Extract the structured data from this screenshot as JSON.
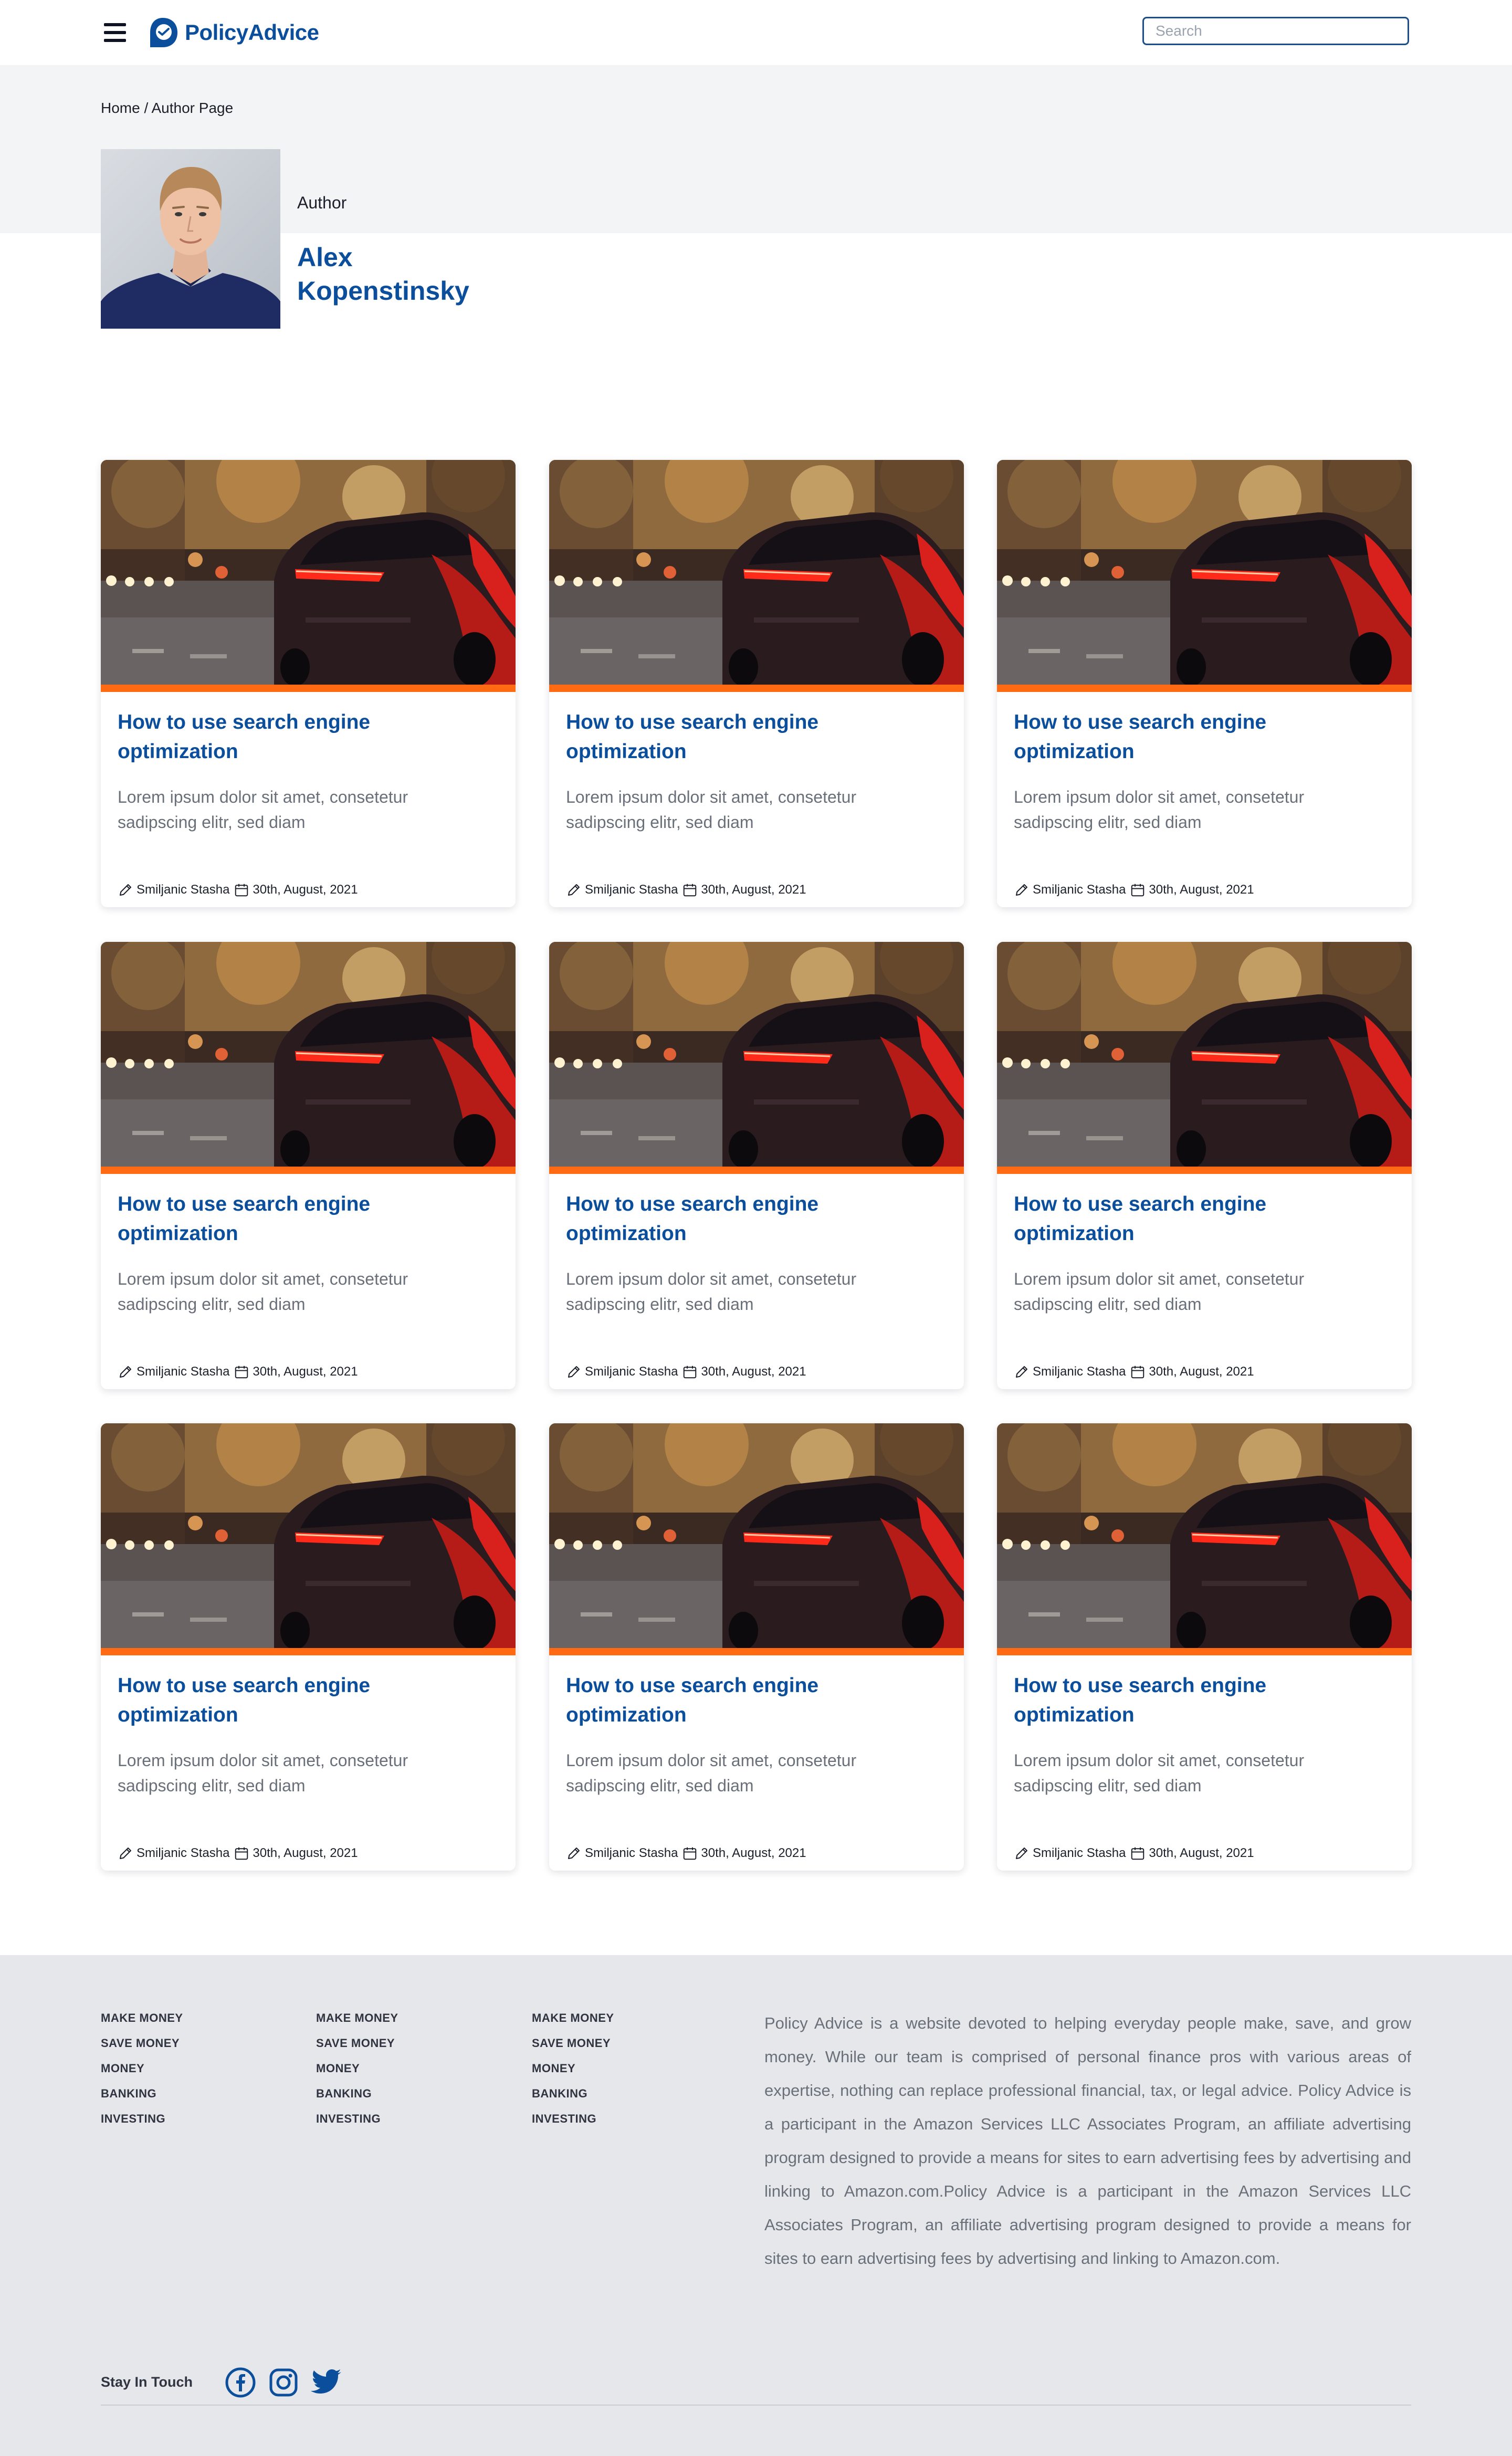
{
  "header": {
    "logo_text": "PolicyAdvice",
    "search_placeholder": "Search"
  },
  "breadcrumb": {
    "home": "Home",
    "separator": " / ",
    "current": "Author Page"
  },
  "author": {
    "label": "Author",
    "first_name": "Alex",
    "last_name": "Kopenstinsky"
  },
  "articles": [
    {
      "title": "How to use search engine optimization",
      "excerpt": "Lorem ipsum dolor sit amet, consetetur sadipscing elitr, sed diam",
      "author": "Smiljanic Stasha",
      "date": "30th, August, 2021"
    },
    {
      "title": "How to use search engine optimization",
      "excerpt": "Lorem ipsum dolor sit amet, consetetur sadipscing elitr, sed diam",
      "author": "Smiljanic Stasha",
      "date": "30th, August, 2021"
    },
    {
      "title": "How to use search engine optimization",
      "excerpt": "Lorem ipsum dolor sit amet, consetetur sadipscing elitr, sed diam",
      "author": "Smiljanic Stasha",
      "date": "30th, August, 2021"
    },
    {
      "title": "How to use search engine optimization",
      "excerpt": "Lorem ipsum dolor sit amet, consetetur sadipscing elitr, sed diam",
      "author": "Smiljanic Stasha",
      "date": "30th, August, 2021"
    },
    {
      "title": "How to use search engine optimization",
      "excerpt": "Lorem ipsum dolor sit amet, consetetur sadipscing elitr, sed diam",
      "author": "Smiljanic Stasha",
      "date": "30th, August, 2021"
    },
    {
      "title": "How to use search engine optimization",
      "excerpt": "Lorem ipsum dolor sit amet, consetetur sadipscing elitr, sed diam",
      "author": "Smiljanic Stasha",
      "date": "30th, August, 2021"
    },
    {
      "title": "How to use search engine optimization",
      "excerpt": "Lorem ipsum dolor sit amet, consetetur sadipscing elitr, sed diam",
      "author": "Smiljanic Stasha",
      "date": "30th, August, 2021"
    },
    {
      "title": "How to use search engine optimization",
      "excerpt": "Lorem ipsum dolor sit amet, consetetur sadipscing elitr, sed diam",
      "author": "Smiljanic Stasha",
      "date": "30th, August, 2021"
    },
    {
      "title": "How to use search engine optimization",
      "excerpt": "Lorem ipsum dolor sit amet, consetetur sadipscing elitr, sed diam",
      "author": "Smiljanic Stasha",
      "date": "30th, August, 2021"
    }
  ],
  "footer": {
    "columns": [
      {
        "links": [
          "MAKE MONEY",
          "SAVE MONEY",
          "MONEY",
          "BANKING",
          "INVESTING"
        ]
      },
      {
        "links": [
          "MAKE MONEY",
          "SAVE MONEY",
          "MONEY",
          "BANKING",
          "INVESTING"
        ]
      },
      {
        "links": [
          "MAKE MONEY",
          "SAVE MONEY",
          "MONEY",
          "BANKING",
          "INVESTING"
        ]
      }
    ],
    "about": "Policy Advice is a website devoted to helping everyday people make, save, and grow money. While our team is comprised of personal finance pros with various areas of expertise, nothing can replace professional financial, tax, or legal advice. Policy Advice is a participant in the Amazon Services LLC Associates Program, an affiliate advertising program designed to provide a means for sites to earn advertising fees by advertising and linking to Amazon.com.Policy Advice is a participant in the Amazon Services LLC Associates Program, an affiliate advertising program designed to provide a means for sites to earn advertising fees by advertising and linking to Amazon.com.",
    "stay_in_touch": "Stay In Touch",
    "social": [
      "facebook-icon",
      "instagram-icon",
      "twitter-icon"
    ]
  },
  "colors": {
    "brand_blue": "#0b4e9c",
    "accent_orange": "#ff6a13",
    "footer_bg": "#e5e7eb",
    "hero_bg": "#f3f4f6"
  }
}
